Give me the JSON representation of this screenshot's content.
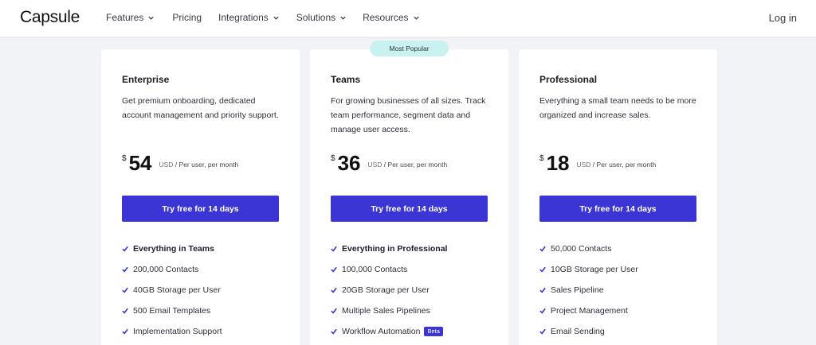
{
  "header": {
    "logo": "Capsule",
    "nav": [
      {
        "label": "Features",
        "has_dropdown": true
      },
      {
        "label": "Pricing",
        "has_dropdown": false
      },
      {
        "label": "Integrations",
        "has_dropdown": true
      },
      {
        "label": "Solutions",
        "has_dropdown": true
      },
      {
        "label": "Resources",
        "has_dropdown": true
      }
    ],
    "login": "Log in"
  },
  "badge": "Most Popular",
  "colors": {
    "accent": "#3a35d4",
    "badge_bg": "#c9f1ef",
    "page_bg": "#f2f3f6"
  },
  "plans": [
    {
      "name": "Enterprise",
      "description": "Get premium onboarding, dedicated account management and priority support.",
      "currency": "$",
      "price": "54",
      "usd": "USD",
      "per": " / Per user, per month",
      "cta": "Try free for 14 days",
      "features": [
        {
          "label": "Everything in Teams",
          "bold": true
        },
        {
          "label": "200,000 Contacts"
        },
        {
          "label": "40GB Storage per User"
        },
        {
          "label": "500 Email Templates"
        },
        {
          "label": "Implementation Support"
        }
      ]
    },
    {
      "name": "Teams",
      "description": "For growing businesses of all sizes. Track team performance, segment data and manage user access.",
      "currency": "$",
      "price": "36",
      "usd": "USD",
      "per": " / Per user, per month",
      "cta": "Try free for 14 days",
      "features": [
        {
          "label": "Everything in Professional",
          "bold": true
        },
        {
          "label": "100,000 Contacts"
        },
        {
          "label": "20GB Storage per User"
        },
        {
          "label": "Multiple Sales Pipelines"
        },
        {
          "label": "Workflow Automation",
          "badge": "Beta"
        }
      ]
    },
    {
      "name": "Professional",
      "description": "Everything a small team needs to be more organized and increase sales.",
      "currency": "$",
      "price": "18",
      "usd": "USD",
      "per": " / Per user, per month",
      "cta": "Try free for 14 days",
      "features": [
        {
          "label": "50,000 Contacts"
        },
        {
          "label": "10GB Storage per User"
        },
        {
          "label": "Sales Pipeline"
        },
        {
          "label": "Project Management"
        },
        {
          "label": "Email Sending"
        }
      ]
    }
  ]
}
